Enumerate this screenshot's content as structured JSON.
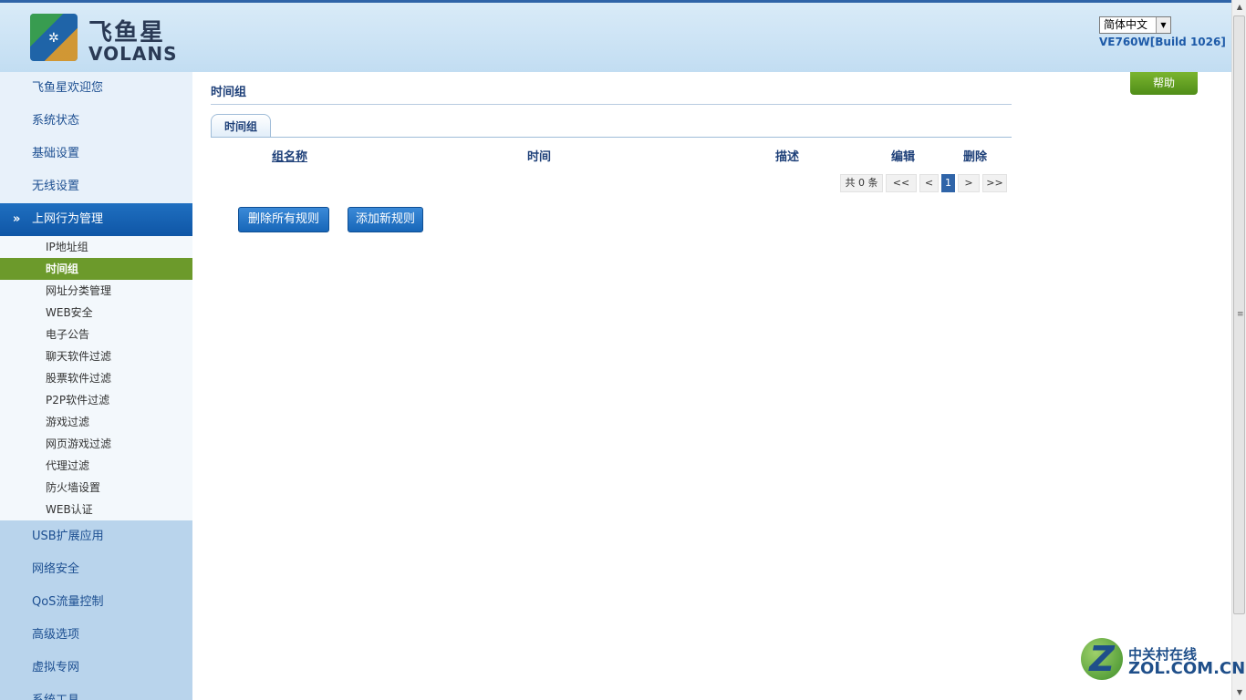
{
  "header": {
    "logo_cn": "飞鱼星",
    "logo_en": "VOLANS",
    "language": "简体中文",
    "version": "VE760W[Build 1026]"
  },
  "sidebar": {
    "top_items": [
      {
        "label": "飞鱼星欢迎您"
      },
      {
        "label": "系统状态"
      },
      {
        "label": "基础设置"
      },
      {
        "label": "无线设置"
      }
    ],
    "active_section": {
      "label": "上网行为管理",
      "icon": "double-chevron-down-icon"
    },
    "sub_items": [
      {
        "label": "IP地址组"
      },
      {
        "label": "时间组",
        "selected": true
      },
      {
        "label": "网址分类管理"
      },
      {
        "label": "WEB安全"
      },
      {
        "label": "电子公告"
      },
      {
        "label": "聊天软件过滤"
      },
      {
        "label": "股票软件过滤"
      },
      {
        "label": "P2P软件过滤"
      },
      {
        "label": "游戏过滤"
      },
      {
        "label": "网页游戏过滤"
      },
      {
        "label": "代理过滤"
      },
      {
        "label": "防火墙设置"
      },
      {
        "label": "WEB认证"
      }
    ],
    "bottom_items": [
      {
        "label": "USB扩展应用"
      },
      {
        "label": "网络安全"
      },
      {
        "label": "QoS流量控制"
      },
      {
        "label": "高级选项"
      },
      {
        "label": "虚拟专网"
      },
      {
        "label": "系统工具"
      }
    ]
  },
  "main": {
    "title": "时间组",
    "help": "帮助",
    "tab": "时间组",
    "columns": [
      "组名称",
      "时间",
      "描述",
      "编辑",
      "删除"
    ],
    "rows": [],
    "pager": {
      "total": "共 0 条",
      "first": "<<",
      "prev": "<",
      "page": "1",
      "next": ">",
      "last": ">>"
    },
    "buttons": {
      "delete_all": "删除所有规则",
      "add_new": "添加新规则"
    }
  },
  "watermark": {
    "cn": "中关村在线",
    "en": "ZOL.COM.CN",
    "mark": "Z"
  }
}
